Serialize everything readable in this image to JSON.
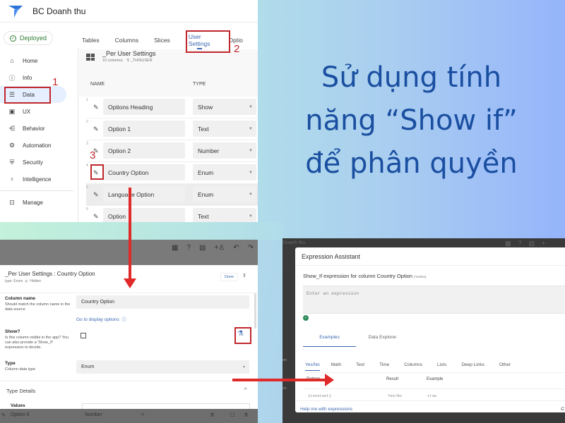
{
  "headline": {
    "line1": "Sử dụng tính",
    "line2": "năng “Show if”",
    "line3": "để phân quyền",
    "color": "#1a4ea0"
  },
  "app": {
    "title": "BC Doanh thu",
    "status": "Deployed",
    "tabs": [
      {
        "label": "Tables"
      },
      {
        "label": "Columns"
      },
      {
        "label": "Slices"
      },
      {
        "label": "User Settings"
      },
      {
        "label": "Optio"
      }
    ],
    "sidebar": [
      {
        "label": "Home",
        "icon": "home-icon"
      },
      {
        "label": "Info",
        "icon": "info-icon"
      },
      {
        "label": "Data",
        "icon": "data-icon"
      },
      {
        "label": "UX",
        "icon": "ux-icon"
      },
      {
        "label": "Behavior",
        "icon": "behavior-icon"
      },
      {
        "label": "Automation",
        "icon": "automation-icon"
      },
      {
        "label": "Security",
        "icon": "security-icon"
      },
      {
        "label": "Intelligence",
        "icon": "intelligence-icon"
      },
      {
        "label": "Manage",
        "icon": "manage-icon"
      }
    ],
    "table": {
      "title": "_Per User Settings",
      "columns_count": "10 columns:",
      "key": "_THISUSER",
      "headers": {
        "name": "NAME",
        "type": "TYPE"
      },
      "rows": [
        {
          "num": "1",
          "name": "Options Heading",
          "type": "Show"
        },
        {
          "num": "2",
          "name": "Option 1",
          "type": "Text"
        },
        {
          "num": "3",
          "name": "Option 2",
          "type": "Number"
        },
        {
          "num": "4",
          "name": "Country Option",
          "type": "Enum"
        },
        {
          "num": "5",
          "name": "Language Option",
          "type": "Enum"
        },
        {
          "num": "6",
          "name": "Option",
          "type": "Text"
        }
      ]
    }
  },
  "annotations": {
    "step1": "1",
    "step2": "2",
    "step3": "3",
    "color": "#c0272d"
  },
  "column_editor": {
    "title": "_Per User Settings : Country Option",
    "subtitle_type": "type: Enum",
    "subtitle_hidden": "Hidden",
    "done_label": "Done",
    "column_name": {
      "label": "Column name",
      "help": "Should match the column name in the data source",
      "value": "Country Option"
    },
    "display_link": "Go to display options",
    "show": {
      "label": "Show?",
      "help": "Is this column visible in the app? You can also provide a 'Show_If' expression to decide.",
      "checked": false
    },
    "type": {
      "label": "Type",
      "help": "Column data type",
      "value": "Enum"
    },
    "type_details": "Type Details",
    "values_label": "Values",
    "footer_row": {
      "name": "Option 6",
      "type": "Number",
      "formula": "="
    }
  },
  "expression_assistant": {
    "bg_title": "Doanh thu",
    "title": "Expression Assistant",
    "subtitle": "Show_If expression for column Country Option",
    "subtitle_type": "(Yes/No)",
    "placeholder": "Enter an expression",
    "tabs": [
      {
        "label": "Examples"
      },
      {
        "label": "Data Explorer"
      }
    ],
    "categories": [
      {
        "label": "Yes/No"
      },
      {
        "label": "Math"
      },
      {
        "label": "Text"
      },
      {
        "label": "Time"
      },
      {
        "label": "Columns"
      },
      {
        "label": "Lists"
      },
      {
        "label": "Deep Links"
      },
      {
        "label": "Other"
      }
    ],
    "table_headers": {
      "pattern": "Pattern",
      "result": "Result",
      "example": "Example"
    },
    "example_row": {
      "pattern": "{constant}",
      "result": "Yes/No",
      "example": "true"
    },
    "help_link": "Help me with expressions",
    "close_partial": "C",
    "bg_side1": "on",
    "bg_side2": "ce"
  }
}
